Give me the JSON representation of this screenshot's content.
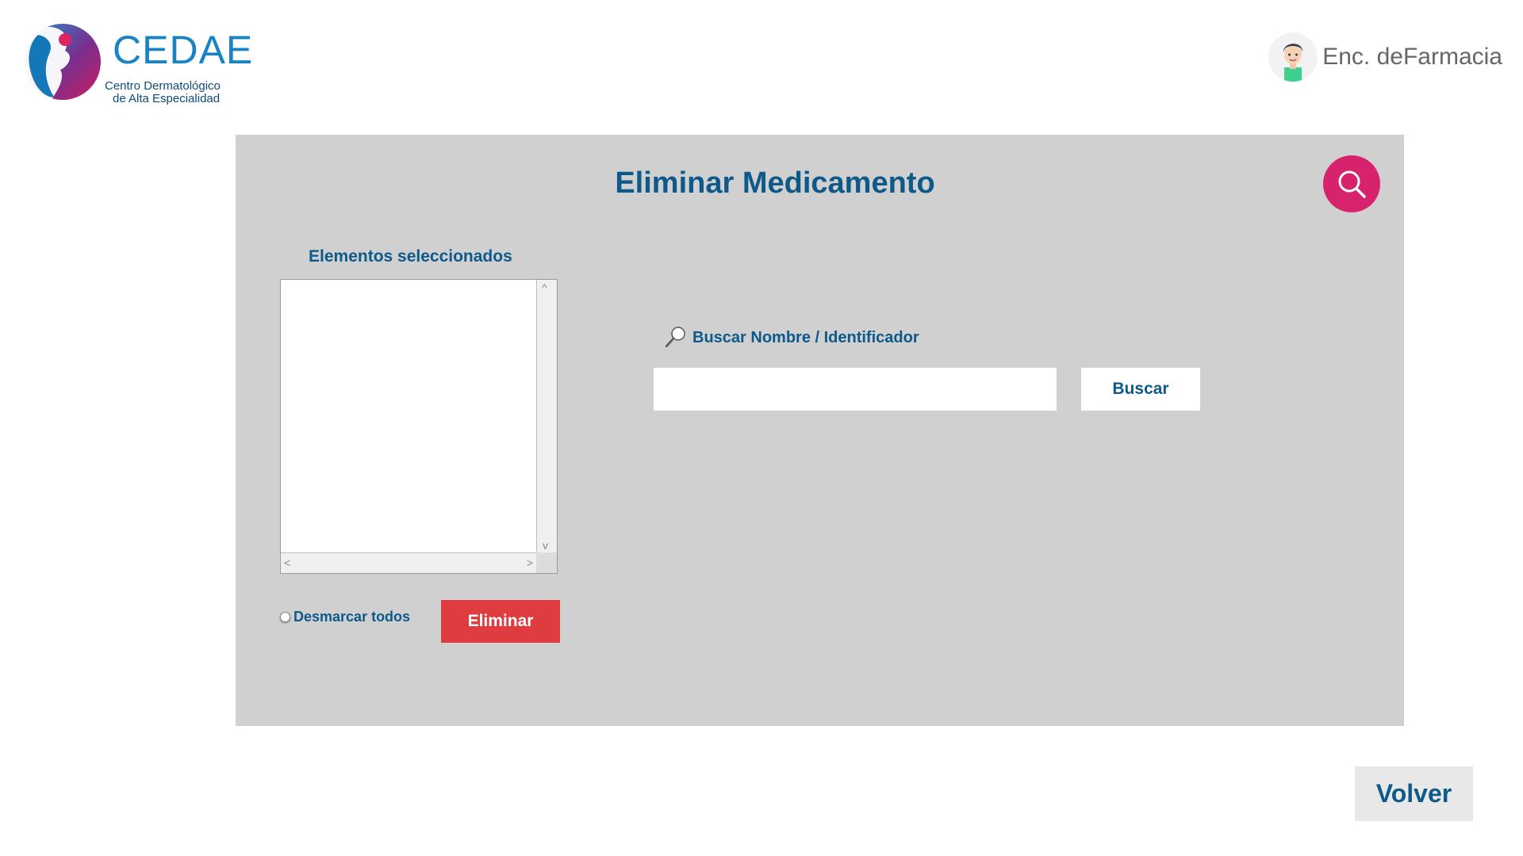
{
  "header": {
    "logo_name": "CEDAE",
    "logo_subtitle_line1": "Centro Dermatológico",
    "logo_subtitle_line2": "de Alta Especialidad",
    "user_role": "Enc. deFarmacia"
  },
  "panel": {
    "title": "Eliminar Medicamento",
    "selected_label": "Elementos seleccionados",
    "selected_items": [],
    "unmark_all_label": "Desmarcar todos",
    "delete_button": "Eliminar",
    "search_label": "Buscar Nombre / Identificador",
    "search_value": "",
    "search_button": "Buscar"
  },
  "footer": {
    "back_button": "Volver"
  },
  "colors": {
    "brand_blue": "#0d5a8a",
    "logo_blue": "#1a83c4",
    "accent_pink": "#d7226e",
    "delete_red": "#de3c3f",
    "panel_gray": "#d0d0d0"
  },
  "icons": [
    "cedae-logo-icon",
    "user-avatar-icon",
    "search-icon",
    "magnifier-icon",
    "arrow-up-icon",
    "arrow-down-icon",
    "arrow-left-icon",
    "arrow-right-icon"
  ]
}
